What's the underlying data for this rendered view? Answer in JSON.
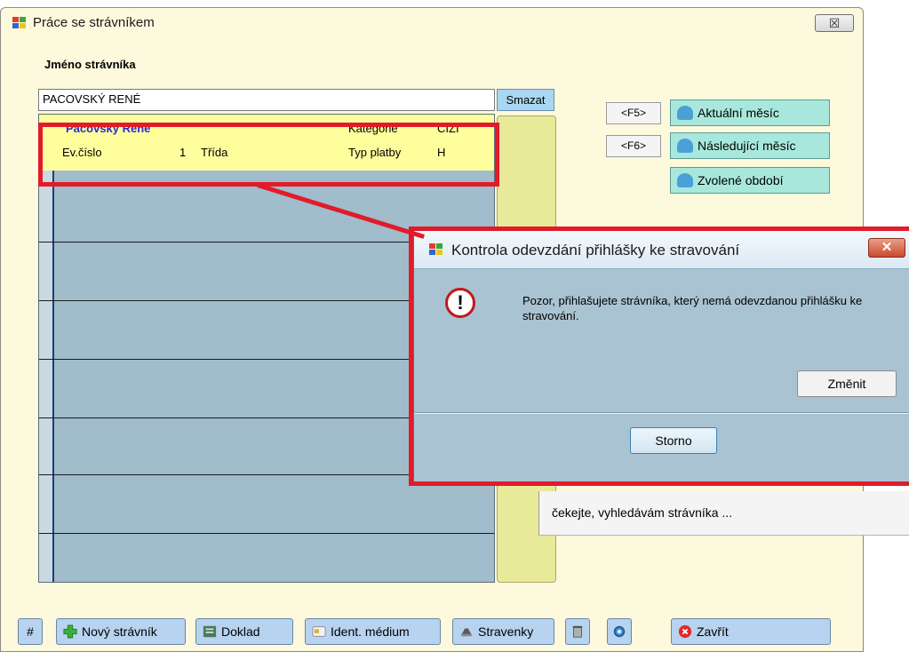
{
  "window": {
    "title": "Práce se strávníkem",
    "close_label": "☒"
  },
  "form": {
    "name_label": "Jméno strávníka",
    "name_value": "PACOVSKÝ RENÉ",
    "clear_button": "Smazat"
  },
  "selected": {
    "name": "Pacovský René",
    "kategorie_label": "Kategorie",
    "kategorie_value": "CIZI",
    "evcislo_label": "Ev.číslo",
    "evcislo_value": "1",
    "trida_label": "Třída",
    "typ_platby_label": "Typ platby",
    "typ_platby_value": "H"
  },
  "right_panel": {
    "f5": "<F5>",
    "f6": "<F6>",
    "current_month": "Aktuální měsíc",
    "next_month": "Následující měsíc",
    "selected_period": "Zvolené období"
  },
  "toolbar": {
    "hash": "#",
    "new_diner": "Nový strávník",
    "receipt": "Doklad",
    "ident_medium": "Ident. médium",
    "tickets": "Stravenky",
    "close": "Zavřít"
  },
  "dialog": {
    "title": "Kontrola odevzdání přihlášky ke stravování",
    "close_label": "✕",
    "warning_glyph": "!",
    "message": "Pozor, přihlašujete strávníka, který nemá odevzdanou přihlášku ke stravování.",
    "change_button": "Změnit",
    "cancel_button": "Storno"
  },
  "status": {
    "waiting": "čekejte, vyhledávám strávníka ..."
  },
  "colors": {
    "highlight": "#e01c2a",
    "window_bg": "#fdf9dc",
    "list_bg": "#a1bccb",
    "dialog_bg": "#a9c3d2"
  }
}
